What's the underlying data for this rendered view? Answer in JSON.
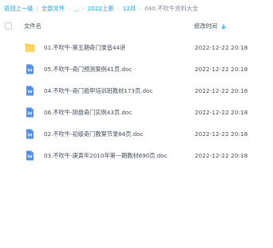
{
  "breadcrumb": {
    "back": "返回上一级",
    "sep": "|",
    "items": [
      {
        "label": "全部文件"
      },
      {
        "label": "..."
      },
      {
        "label": "2022上新"
      },
      {
        "label": "12月"
      }
    ],
    "current": "040.不吹牛资料大全",
    "arrow": "›"
  },
  "header": {
    "name_label": "文件名",
    "time_label": "修改时间",
    "sort_icon": "sort-descending-icon"
  },
  "files": [
    {
      "name": "01.不吹牛-第五期奇门录音44讲",
      "modified": "2022-12-22 20:18",
      "icon": "folder-icon",
      "color": "#ffc53d"
    },
    {
      "name": "05.不吹牛-奇门预测案例41页.doc",
      "modified": "2022-12-22 20:18",
      "icon": "word-doc-icon",
      "color": "#4a8ef8"
    },
    {
      "name": "04.不吹牛-奇门遁甲培训班教材173页.doc",
      "modified": "2022-12-22 20:18",
      "icon": "word-doc-icon",
      "color": "#4a8ef8"
    },
    {
      "name": "06.不吹牛-阴盘奇门实例43页.doc",
      "modified": "2022-12-22 20:18",
      "icon": "word-doc-icon",
      "color": "#4a8ef8"
    },
    {
      "name": "02.不吹牛-初级奇门教案节录84页.doc",
      "modified": "2022-12-22 20:18",
      "icon": "word-doc-icon",
      "color": "#4a8ef8"
    },
    {
      "name": "03.不吹牛-庚寅年2010年第一期教材690页.doc",
      "modified": "2022-12-22 20:18",
      "icon": "word-doc-icon",
      "color": "#4a8ef8"
    }
  ]
}
